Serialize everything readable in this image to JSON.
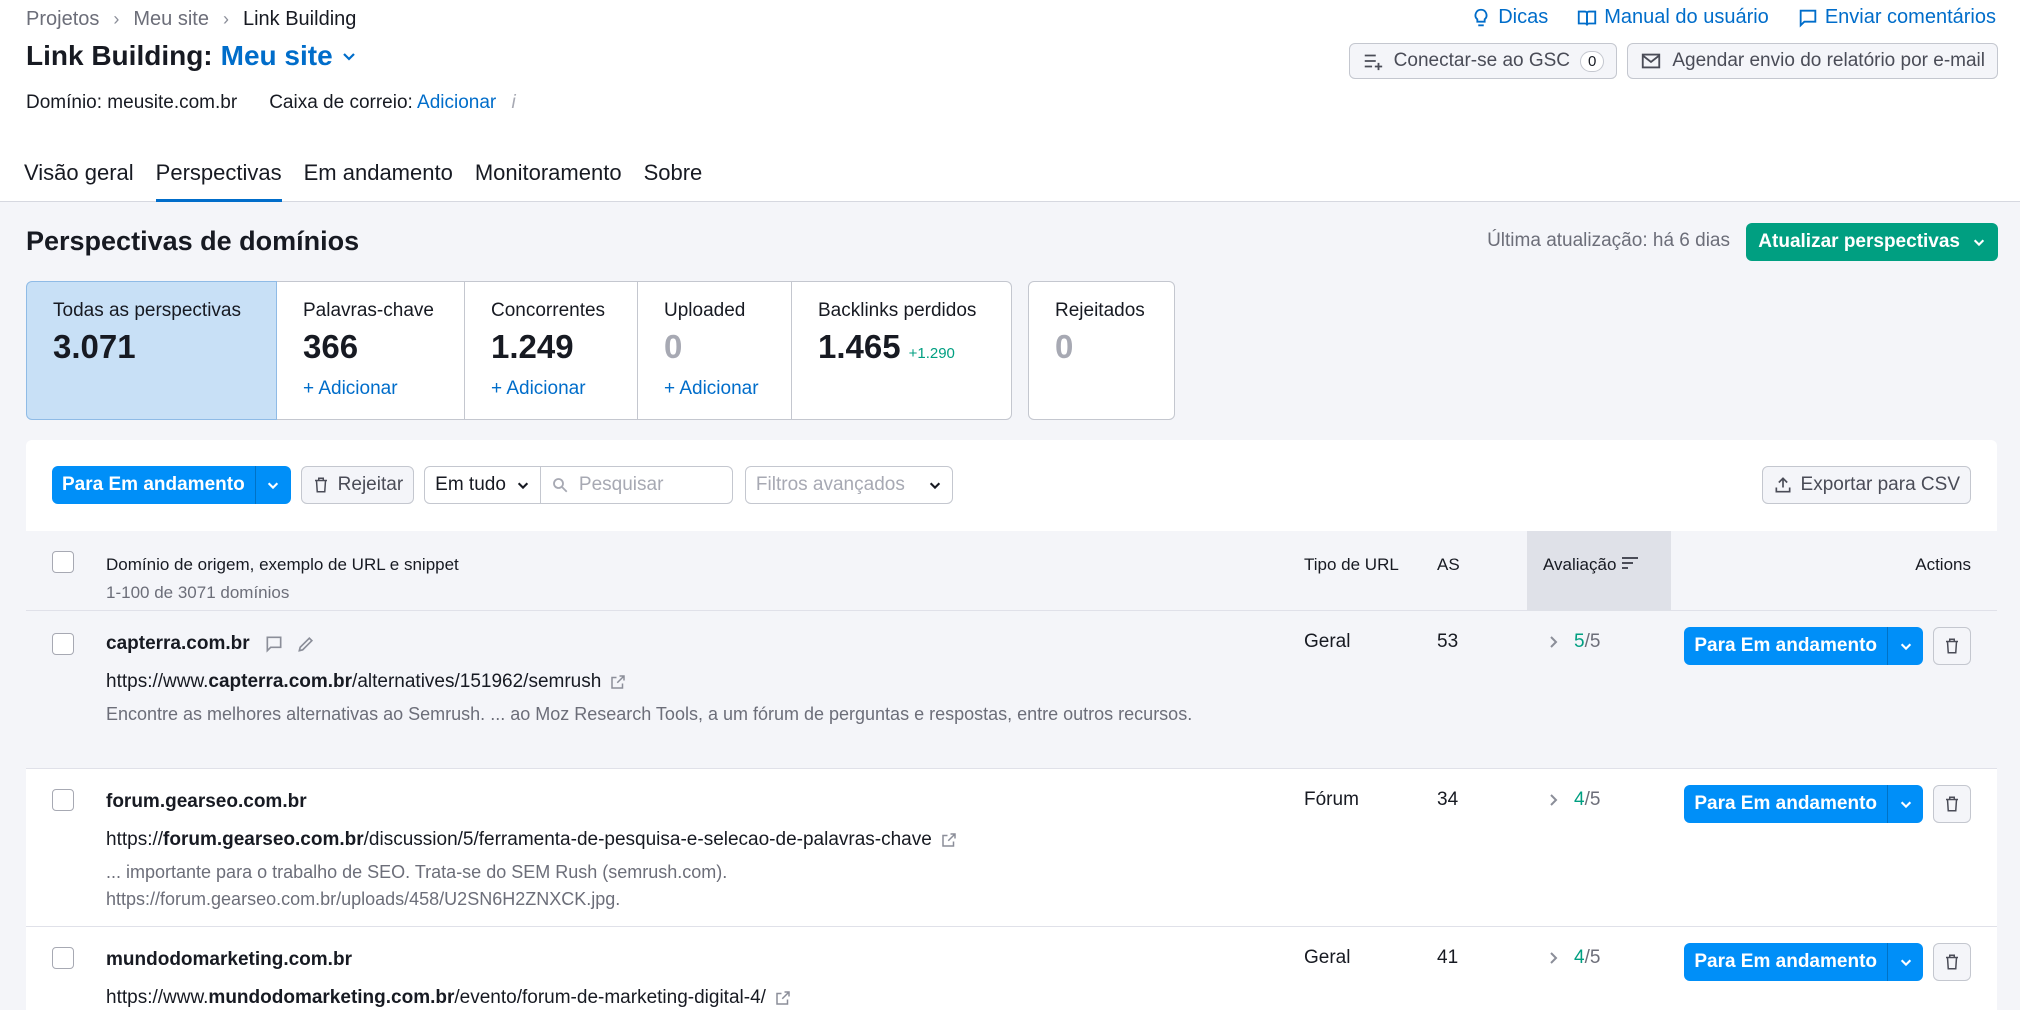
{
  "breadcrumb": [
    "Projetos",
    "Meu site",
    "Link Building"
  ],
  "toplinks": {
    "tips": "Dicas",
    "manual": "Manual do usuário",
    "feedback": "Enviar comentários"
  },
  "header": {
    "title": "Link Building:",
    "site": "Meu site",
    "gsc_label": "Conectar-se ao GSC",
    "gsc_count": "0",
    "email_report": "Agendar envio do relatório por e-mail",
    "domain_label": "Domínio: meusite.com.br",
    "mailbox_label": "Caixa de correio:",
    "mailbox_link": "Adicionar",
    "info_glyph": "i"
  },
  "tabs": [
    "Visão geral",
    "Perspectivas",
    "Em andamento",
    "Monitoramento",
    "Sobre"
  ],
  "section": {
    "title": "Perspectivas de domínios",
    "last_update": "Última atualização: há 6 dias",
    "update_btn": "Atualizar perspectivas"
  },
  "cards": [
    {
      "label": "Todas as perspectivas",
      "value": "3.071"
    },
    {
      "label": "Palavras-chave",
      "value": "366",
      "add": "+ Adicionar"
    },
    {
      "label": "Concorrentes",
      "value": "1.249",
      "add": "+ Adicionar"
    },
    {
      "label": "Uploaded",
      "value": "0",
      "add": "+ Adicionar"
    },
    {
      "label": "Backlinks perdidos",
      "value": "1.465",
      "delta": "+1.290"
    },
    {
      "label": "Rejeitados",
      "value": "0"
    }
  ],
  "toolbar": {
    "move_btn": "Para Em andamento",
    "reject_btn": "Rejeitar",
    "scope": "Em tudo",
    "search_placeholder": "Pesquisar",
    "filters": "Filtros avançados",
    "export": "Exportar para CSV"
  },
  "table": {
    "col_domain": "Domínio de origem, exemplo de URL e snippet",
    "col_domain_sub": "1-100 de 3071 domínios",
    "col_type": "Tipo de URL",
    "col_as": "AS",
    "col_rating": "Avaliação",
    "col_actions": "Actions",
    "action_btn": "Para Em andamento",
    "rows": [
      {
        "domain": "capterra.com.br",
        "url_pre": "https://www.",
        "url_bold": "capterra.com.br",
        "url_post": "/alternatives/151962/semrush",
        "snippet": "Encontre as melhores alternativas ao Semrush. ... ao Moz Research Tools, a um fórum de perguntas e respostas, entre outros recursos.",
        "type": "Geral",
        "as": "53",
        "rating": "5",
        "rating_max": "/5"
      },
      {
        "domain": "forum.gearseo.com.br",
        "url_pre": "https://",
        "url_bold": "forum.gearseo.com.br",
        "url_post": "/discussion/5/ferramenta-de-pesquisa-e-selecao-de-palavras-chave",
        "snippet": "... importante para o trabalho de SEO. Trata-se do SEM Rush (semrush.com). https://forum.gearseo.com.br/uploads/458/U2SN6H2ZNXCK.jpg.",
        "type": "Fórum",
        "as": "34",
        "rating": "4",
        "rating_max": "/5"
      },
      {
        "domain": "mundodomarketing.com.br",
        "url_pre": "https://www.",
        "url_bold": "mundodomarketing.com.br",
        "url_post": "/evento/forum-de-marketing-digital-4/",
        "snippet": "",
        "type": "Geral",
        "as": "41",
        "rating": "4",
        "rating_max": "/5"
      }
    ]
  }
}
